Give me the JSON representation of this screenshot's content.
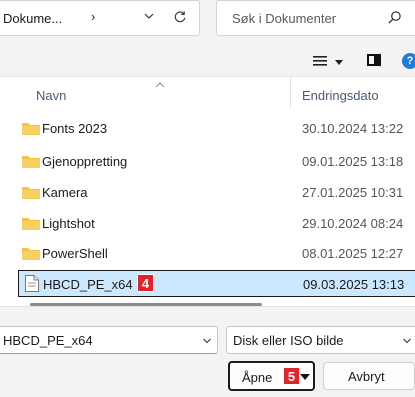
{
  "address_bar": {
    "path": "Dokume...",
    "separator": "›"
  },
  "search": {
    "placeholder": "Søk i Dokumenter"
  },
  "help_label": "?",
  "columns": {
    "name": "Navn",
    "date": "Endringsdato"
  },
  "files": [
    {
      "name": "Fonts 2023",
      "date": "30.10.2024 13:22",
      "kind": "folder"
    },
    {
      "name": "Gjenoppretting",
      "date": "09.01.2025 13:18",
      "kind": "folder"
    },
    {
      "name": "Kamera",
      "date": "27.01.2025 10:31",
      "kind": "folder"
    },
    {
      "name": "Lightshot",
      "date": "29.10.2024 08:24",
      "kind": "folder"
    },
    {
      "name": "PowerShell",
      "date": "08.01.2025 12:27",
      "kind": "folder"
    },
    {
      "name": "HBCD_PE_x64",
      "date": "09.03.2025 13:13",
      "kind": "file",
      "selected": true
    }
  ],
  "badges": {
    "file": "4",
    "open": "5"
  },
  "bottom": {
    "filename_value": "HBCD_PE_x64",
    "filetype_value": "Disk eller ISO bilde",
    "open_label": "Åpne",
    "cancel_label": "Avbryt"
  },
  "colors": {
    "selection": "#cce8ff",
    "badge": "#e0242b",
    "folder": "#f5c242"
  }
}
